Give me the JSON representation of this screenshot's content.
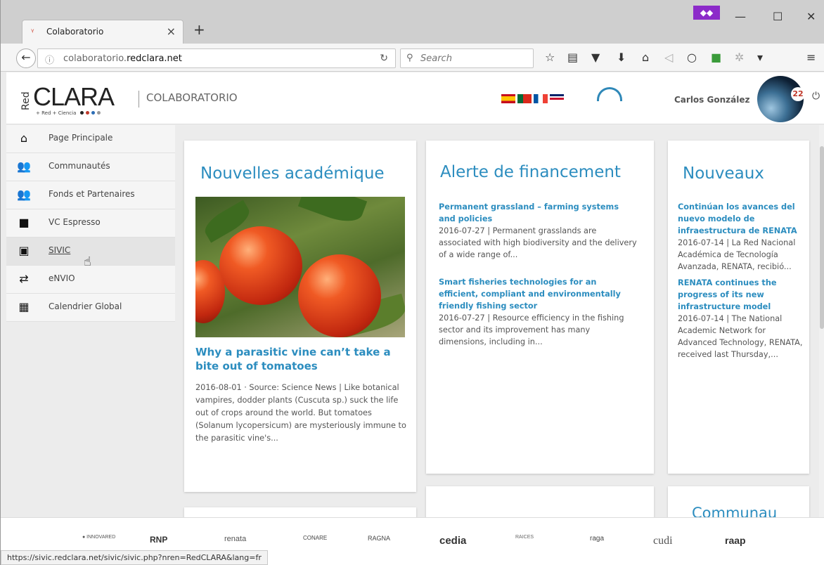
{
  "browser": {
    "tab_title": "Colaboratorio",
    "tab_close": "×",
    "new_tab": "+",
    "url_prefix": "colaboratorio.",
    "url_domain": "redclara.net",
    "search_placeholder": "Search",
    "status_url": "https://sivic.redclara.net/sivic/sivic.php?nren=RedCLARA&lang=fr",
    "private_icon": "mask-icon"
  },
  "header": {
    "logo_red": "Red",
    "logo_text": "CLARA",
    "logo_tagline": "+ Red  + Ciencia",
    "brand": "COLABORATORIO",
    "user_name": "Carlos González",
    "notification_count": "22"
  },
  "sidebar": {
    "items": [
      {
        "label": "Page Principale",
        "icon": "home-icon"
      },
      {
        "label": "Communautés",
        "icon": "group-icon"
      },
      {
        "label": "Fonds et Partenaires",
        "icon": "partners-icon"
      },
      {
        "label": "VC Espresso",
        "icon": "video-camera-icon"
      },
      {
        "label": "SIVIC",
        "icon": "sivic-icon"
      },
      {
        "label": "eNVIO",
        "icon": "transfer-icon"
      },
      {
        "label": "Calendrier Global",
        "icon": "calendar-icon"
      }
    ]
  },
  "news": {
    "heading": "Nouvelles académique",
    "title": "Why a parasitic vine can’t take a bite out of tomatoes",
    "text": "2016-08-01 · Source: Science News | Like botanical vampires, dodder plants (Cuscuta sp.) suck the life out of crops around the world.  But tomatoes (Solanum lycopersicum) are mysteriously immune to the parasitic vine's..."
  },
  "funding": {
    "heading": "Alerte de financement",
    "items": [
      {
        "title": "Permanent grassland – farming systems and policies",
        "text": "2016-07-27 | Permanent grasslands are associated with high biodiversity and the delivery of a wide range of..."
      },
      {
        "title": "Smart fisheries technologies for an efficient, compliant and environmentally friendly fishing sector",
        "text": "2016-07-27 | Resource efficiency in the fishing sector and its improvement has many dimensions, including in..."
      }
    ]
  },
  "nouveaux": {
    "heading": "Nouveaux",
    "items": [
      {
        "title": "Continúan los avances del nuevo modelo de infraestructura de RENATA",
        "text": "2016-07-14 | La Red Nacional Académica de Tecnología Avanzada, RENATA, recibió..."
      },
      {
        "title": "RENATA continues the progress of its new infrastructure model",
        "text": "2016-07-14 | The National Academic Network for Advanced Technology, RENATA, received last Thursday,..."
      }
    ]
  },
  "bottom_card_heading": "Communau",
  "partners": [
    "RNP",
    "renata",
    "CONARE",
    "RAGNA",
    "cedia",
    "RAICES",
    "raga",
    "cudi",
    "raap"
  ],
  "colors": {
    "accent": "#2c8dbf",
    "private": "#8c2bc9",
    "badge": "#c0392b"
  }
}
